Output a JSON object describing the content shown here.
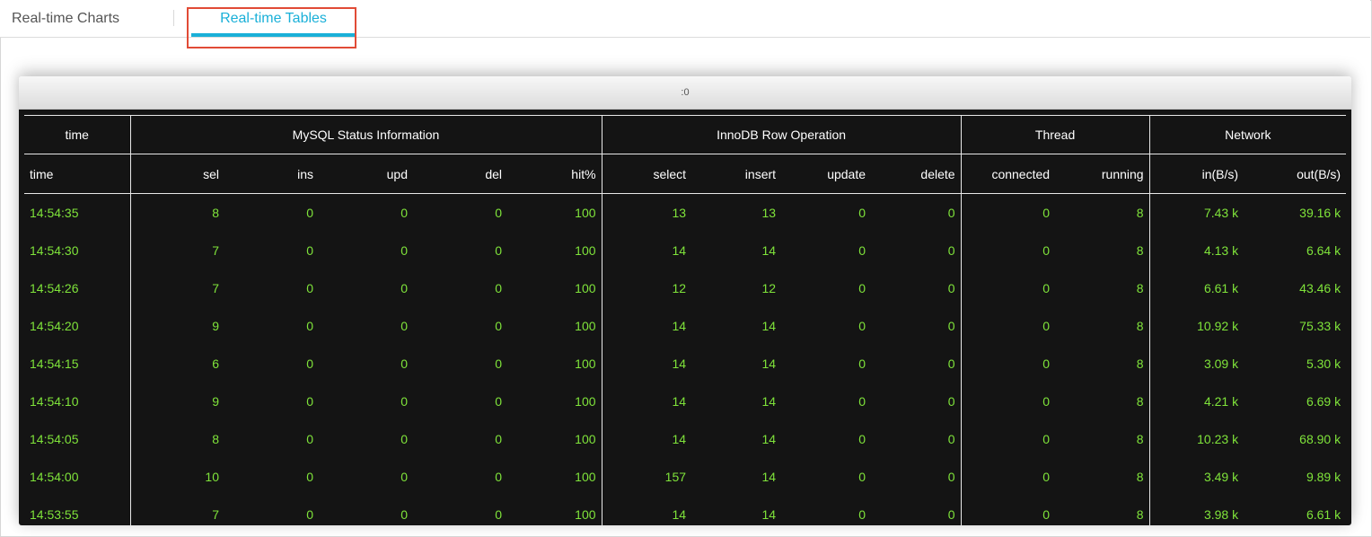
{
  "tabs": {
    "charts_label": "Real-time Charts",
    "tables_label": "Real-time Tables",
    "accent_color": "#1ab0d8",
    "highlight_color": "#e14b36"
  },
  "panel": {
    "title": ":0"
  },
  "table": {
    "groups": {
      "time": "time",
      "mysql": "MySQL Status Information",
      "innodb": "InnoDB Row Operation",
      "thread": "Thread",
      "network": "Network"
    },
    "columns": [
      "time",
      "sel",
      "ins",
      "upd",
      "del",
      "hit%",
      "select",
      "insert",
      "update",
      "delete",
      "connected",
      "running",
      "in(B/s)",
      "out(B/s)"
    ],
    "rows": [
      [
        "14:54:35",
        "8",
        "0",
        "0",
        "0",
        "100",
        "13",
        "13",
        "0",
        "0",
        "0",
        "8",
        "7.43 k",
        "39.16 k"
      ],
      [
        "14:54:30",
        "7",
        "0",
        "0",
        "0",
        "100",
        "14",
        "14",
        "0",
        "0",
        "0",
        "8",
        "4.13 k",
        "6.64 k"
      ],
      [
        "14:54:26",
        "7",
        "0",
        "0",
        "0",
        "100",
        "12",
        "12",
        "0",
        "0",
        "0",
        "8",
        "6.61 k",
        "43.46 k"
      ],
      [
        "14:54:20",
        "9",
        "0",
        "0",
        "0",
        "100",
        "14",
        "14",
        "0",
        "0",
        "0",
        "8",
        "10.92 k",
        "75.33 k"
      ],
      [
        "14:54:15",
        "6",
        "0",
        "0",
        "0",
        "100",
        "14",
        "14",
        "0",
        "0",
        "0",
        "8",
        "3.09 k",
        "5.30 k"
      ],
      [
        "14:54:10",
        "9",
        "0",
        "0",
        "0",
        "100",
        "14",
        "14",
        "0",
        "0",
        "0",
        "8",
        "4.21 k",
        "6.69 k"
      ],
      [
        "14:54:05",
        "8",
        "0",
        "0",
        "0",
        "100",
        "14",
        "14",
        "0",
        "0",
        "0",
        "8",
        "10.23 k",
        "68.90 k"
      ],
      [
        "14:54:00",
        "10",
        "0",
        "0",
        "0",
        "100",
        "157",
        "14",
        "0",
        "0",
        "0",
        "8",
        "3.49 k",
        "9.89 k"
      ],
      [
        "14:53:55",
        "7",
        "0",
        "0",
        "0",
        "100",
        "14",
        "14",
        "0",
        "0",
        "0",
        "8",
        "3.98 k",
        "6.61 k"
      ]
    ],
    "text_color": "#7fe33a",
    "background_color": "#141414"
  }
}
